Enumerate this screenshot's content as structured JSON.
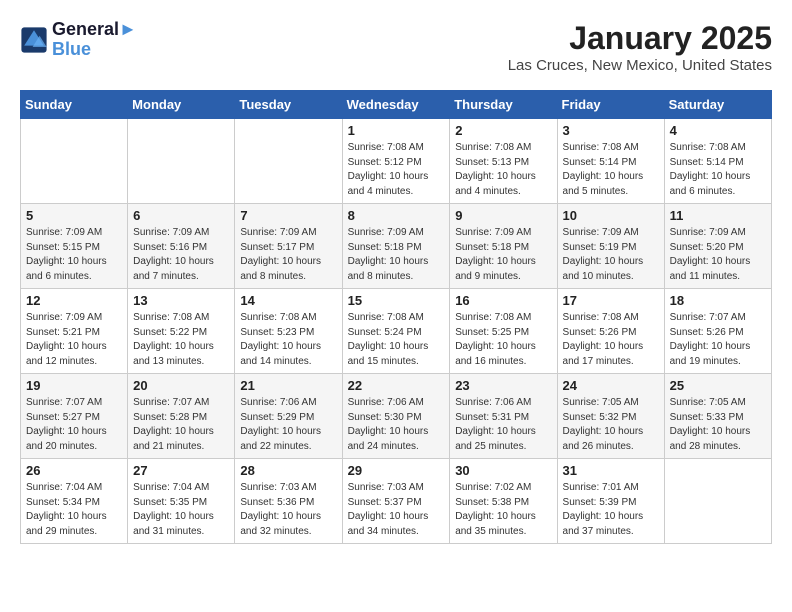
{
  "header": {
    "logo_line1": "General",
    "logo_line2": "Blue",
    "month": "January 2025",
    "location": "Las Cruces, New Mexico, United States"
  },
  "weekdays": [
    "Sunday",
    "Monday",
    "Tuesday",
    "Wednesday",
    "Thursday",
    "Friday",
    "Saturday"
  ],
  "weeks": [
    [
      {
        "day": "",
        "info": ""
      },
      {
        "day": "",
        "info": ""
      },
      {
        "day": "",
        "info": ""
      },
      {
        "day": "1",
        "info": "Sunrise: 7:08 AM\nSunset: 5:12 PM\nDaylight: 10 hours\nand 4 minutes."
      },
      {
        "day": "2",
        "info": "Sunrise: 7:08 AM\nSunset: 5:13 PM\nDaylight: 10 hours\nand 4 minutes."
      },
      {
        "day": "3",
        "info": "Sunrise: 7:08 AM\nSunset: 5:14 PM\nDaylight: 10 hours\nand 5 minutes."
      },
      {
        "day": "4",
        "info": "Sunrise: 7:08 AM\nSunset: 5:14 PM\nDaylight: 10 hours\nand 6 minutes."
      }
    ],
    [
      {
        "day": "5",
        "info": "Sunrise: 7:09 AM\nSunset: 5:15 PM\nDaylight: 10 hours\nand 6 minutes."
      },
      {
        "day": "6",
        "info": "Sunrise: 7:09 AM\nSunset: 5:16 PM\nDaylight: 10 hours\nand 7 minutes."
      },
      {
        "day": "7",
        "info": "Sunrise: 7:09 AM\nSunset: 5:17 PM\nDaylight: 10 hours\nand 8 minutes."
      },
      {
        "day": "8",
        "info": "Sunrise: 7:09 AM\nSunset: 5:18 PM\nDaylight: 10 hours\nand 8 minutes."
      },
      {
        "day": "9",
        "info": "Sunrise: 7:09 AM\nSunset: 5:18 PM\nDaylight: 10 hours\nand 9 minutes."
      },
      {
        "day": "10",
        "info": "Sunrise: 7:09 AM\nSunset: 5:19 PM\nDaylight: 10 hours\nand 10 minutes."
      },
      {
        "day": "11",
        "info": "Sunrise: 7:09 AM\nSunset: 5:20 PM\nDaylight: 10 hours\nand 11 minutes."
      }
    ],
    [
      {
        "day": "12",
        "info": "Sunrise: 7:09 AM\nSunset: 5:21 PM\nDaylight: 10 hours\nand 12 minutes."
      },
      {
        "day": "13",
        "info": "Sunrise: 7:08 AM\nSunset: 5:22 PM\nDaylight: 10 hours\nand 13 minutes."
      },
      {
        "day": "14",
        "info": "Sunrise: 7:08 AM\nSunset: 5:23 PM\nDaylight: 10 hours\nand 14 minutes."
      },
      {
        "day": "15",
        "info": "Sunrise: 7:08 AM\nSunset: 5:24 PM\nDaylight: 10 hours\nand 15 minutes."
      },
      {
        "day": "16",
        "info": "Sunrise: 7:08 AM\nSunset: 5:25 PM\nDaylight: 10 hours\nand 16 minutes."
      },
      {
        "day": "17",
        "info": "Sunrise: 7:08 AM\nSunset: 5:26 PM\nDaylight: 10 hours\nand 17 minutes."
      },
      {
        "day": "18",
        "info": "Sunrise: 7:07 AM\nSunset: 5:26 PM\nDaylight: 10 hours\nand 19 minutes."
      }
    ],
    [
      {
        "day": "19",
        "info": "Sunrise: 7:07 AM\nSunset: 5:27 PM\nDaylight: 10 hours\nand 20 minutes."
      },
      {
        "day": "20",
        "info": "Sunrise: 7:07 AM\nSunset: 5:28 PM\nDaylight: 10 hours\nand 21 minutes."
      },
      {
        "day": "21",
        "info": "Sunrise: 7:06 AM\nSunset: 5:29 PM\nDaylight: 10 hours\nand 22 minutes."
      },
      {
        "day": "22",
        "info": "Sunrise: 7:06 AM\nSunset: 5:30 PM\nDaylight: 10 hours\nand 24 minutes."
      },
      {
        "day": "23",
        "info": "Sunrise: 7:06 AM\nSunset: 5:31 PM\nDaylight: 10 hours\nand 25 minutes."
      },
      {
        "day": "24",
        "info": "Sunrise: 7:05 AM\nSunset: 5:32 PM\nDaylight: 10 hours\nand 26 minutes."
      },
      {
        "day": "25",
        "info": "Sunrise: 7:05 AM\nSunset: 5:33 PM\nDaylight: 10 hours\nand 28 minutes."
      }
    ],
    [
      {
        "day": "26",
        "info": "Sunrise: 7:04 AM\nSunset: 5:34 PM\nDaylight: 10 hours\nand 29 minutes."
      },
      {
        "day": "27",
        "info": "Sunrise: 7:04 AM\nSunset: 5:35 PM\nDaylight: 10 hours\nand 31 minutes."
      },
      {
        "day": "28",
        "info": "Sunrise: 7:03 AM\nSunset: 5:36 PM\nDaylight: 10 hours\nand 32 minutes."
      },
      {
        "day": "29",
        "info": "Sunrise: 7:03 AM\nSunset: 5:37 PM\nDaylight: 10 hours\nand 34 minutes."
      },
      {
        "day": "30",
        "info": "Sunrise: 7:02 AM\nSunset: 5:38 PM\nDaylight: 10 hours\nand 35 minutes."
      },
      {
        "day": "31",
        "info": "Sunrise: 7:01 AM\nSunset: 5:39 PM\nDaylight: 10 hours\nand 37 minutes."
      },
      {
        "day": "",
        "info": ""
      }
    ]
  ]
}
